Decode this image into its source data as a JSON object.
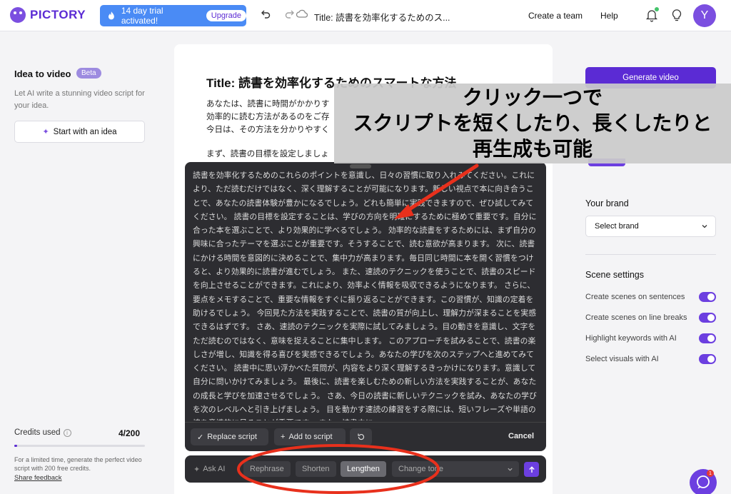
{
  "header": {
    "logo_text": "PICTORY",
    "trial_text": "14 day trial activated!",
    "upgrade_label": "Upgrade",
    "doc_title": "Title: 読書を効率化するためのス...",
    "create_team_label": "Create a team",
    "help_label": "Help",
    "avatar_initial": "Y"
  },
  "left_panel": {
    "title": "Idea to video",
    "beta_badge": "Beta",
    "description": "Let AI write a stunning video script for your idea.",
    "start_button": "Start with an idea",
    "credits_label": "Credits used",
    "credits_value": "4/200",
    "credits_fraction": 0.02,
    "credits_note": "For a limited time, generate the perfect video script with 200 free credits.",
    "feedback_link": "Share feedback"
  },
  "document": {
    "heading": "Title: 読書を効率化するためのスマートな方法",
    "paragraph1": "あなたは、読書に時間がかかりす効率的に読む方法があるのをご存今日は、その方法を分かりやすく",
    "paragraph2": "まず、読書の目標を設定しましょ"
  },
  "popup": {
    "generated_text": "読書を効率化するためのこれらのポイントを意識し、日々の習慣に取り入れみてください。これにより、ただ読むだけではなく、深く理解することが可能になります。新しい視点で本に向き合うことで、あなたの読書体験が豊かになるでしょう。どれも簡単に実践できますので、ぜひ試してみてください。 読書の目標を設定することは、学びの方向を明確にするために極めて重要です。自分に合った本を選ぶことで、より効果的に学べるでしょう。 効率的な読書をするためには、まず自分の興味に合ったテーマを選ぶことが重要です。そうすることで、読む意欲が高まります。 次に、読書にかける時間を意図的に決めることで、集中力が高まります。毎日同じ時間に本を開く習慣をつけると、より効果的に読書が進むでしょう。 また、速読のテクニックを使うことで、読書のスピードを向上させることができます。これにより、効率よく情報を吸収できるようになります。 さらに、要点をメモすることで、重要な情報をすぐに振り返ることができます。この習慣が、知識の定着を助けるでしょう。 今回見た方法を実践することで、読書の質が向上し、理解力が深まることを実感できるはずです。 さあ、速読のテクニックを実際に試してみましょう。目の動きを意識し、文字をただ読むのではなく、意味を捉えることに集中します。 このアプローチを試みることで、読書の楽しさが増し、知識を得る喜びを実感できるでしょう。あなたの学びを次のステップへと進めてみてください。 読書中に思い浮かべた質問が、内容をより深く理解するきっかけになります。意識して自分に問いかけてみましょう。 最後に、読書を楽しむための新しい方法を実践することが、あなたの成長と学びを加速させるでしょう。 さあ、今日の読書に新しいテクニックを試み、あなたの学びを次のレベルへと引き上げましょう。 目を動かす速読の練習をする際には、短いフレーズや単語の塊を意識的に見ることが重要です。 また、読書中に",
    "replace_label": "Replace script",
    "add_label": "Add to script",
    "cancel_label": "Cancel"
  },
  "ai_bar": {
    "ask_ai_placeholder": "Ask AI",
    "rephrase_label": "Rephrase",
    "shorten_label": "Shorten",
    "lengthen_label": "Lengthen",
    "tone_label": "Change tone"
  },
  "right_panel": {
    "generate_label": "Generate video",
    "brand_label": "Your brand",
    "brand_select": "Select brand",
    "scene_settings_label": "Scene settings",
    "toggles": [
      {
        "label": "Create scenes on sentences",
        "on": true
      },
      {
        "label": "Create scenes on line breaks",
        "on": true
      },
      {
        "label": "Highlight keywords with AI",
        "on": true
      },
      {
        "label": "Select visuals with AI",
        "on": true
      }
    ]
  },
  "annotation": {
    "line1": "クリック一つで",
    "line2": "スクリプトを短くしたり、長くしたりと",
    "line3": "再生成も可能"
  },
  "chat": {
    "badge_count": "1"
  },
  "colors": {
    "brand_purple": "#5b2bd4",
    "trial_blue": "#4a8bf5",
    "annotation_red": "#e8301c",
    "popup_bg": "#2d2d31"
  }
}
